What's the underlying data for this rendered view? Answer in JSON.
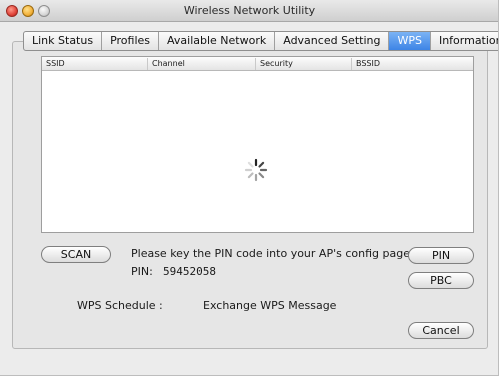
{
  "window": {
    "title": "Wireless Network Utility"
  },
  "tabs": [
    {
      "label": "Link Status"
    },
    {
      "label": "Profiles"
    },
    {
      "label": "Available Network"
    },
    {
      "label": "Advanced Setting"
    },
    {
      "label": "WPS",
      "selected": true
    },
    {
      "label": "Information"
    }
  ],
  "list": {
    "columns": [
      "SSID",
      "Channel",
      "Security",
      "BSSID"
    ],
    "rows": []
  },
  "controls": {
    "scan_label": "SCAN",
    "pin_label": "PIN",
    "pbc_label": "PBC",
    "cancel_label": "Cancel"
  },
  "instructions": {
    "text": "Please key the PIN code into your AP's config page",
    "pin_prefix": "PIN:",
    "pin_value": "59452058"
  },
  "schedule": {
    "label": "WPS Schedule :",
    "status": "Exchange WPS Message"
  },
  "colors": {
    "selected_tab": "#3d84e6",
    "window_bg": "#ececec"
  }
}
